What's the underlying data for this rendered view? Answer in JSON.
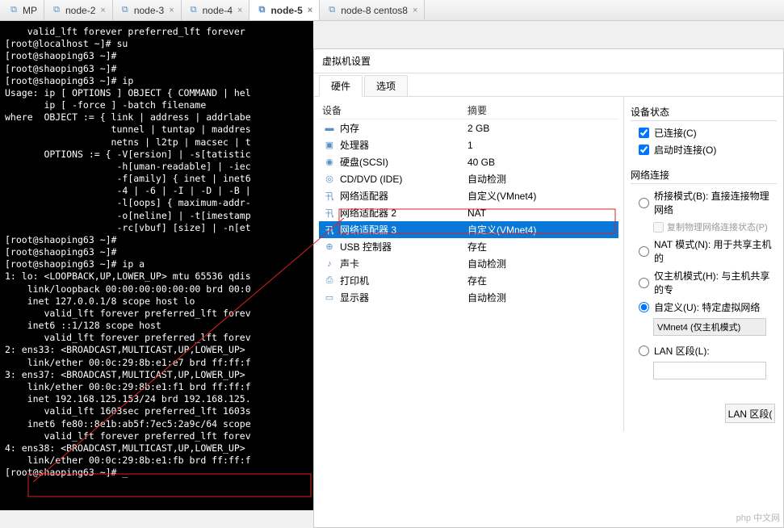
{
  "tabs": [
    {
      "label": "MP"
    },
    {
      "label": "node-2"
    },
    {
      "label": "node-3"
    },
    {
      "label": "node-4"
    },
    {
      "label": "node-5",
      "active": true
    },
    {
      "label": "node-8 centos8"
    }
  ],
  "terminal_lines": [
    "    valid_lft forever preferred_lft forever",
    "[root@localhost ~]# su",
    "[root@shaoping63 ~]#",
    "[root@shaoping63 ~]#",
    "[root@shaoping63 ~]# ip",
    "Usage: ip [ OPTIONS ] OBJECT { COMMAND | hel",
    "       ip [ -force ] -batch filename",
    "where  OBJECT := { link | address | addrlabe",
    "                   tunnel | tuntap | maddres",
    "                   netns | l2tp | macsec | t",
    "       OPTIONS := { -V[ersion] | -s[tatistic",
    "                    -h[uman-readable] | -iec",
    "                    -f[amily] { inet | inet6",
    "                    -4 | -6 | -I | -D | -B |",
    "                    -l[oops] { maximum-addr-",
    "                    -o[neline] | -t[imestamp",
    "                    -rc[vbuf] [size] | -n[et",
    "[root@shaoping63 ~]#",
    "[root@shaoping63 ~]#",
    "[root@shaoping63 ~]# ip a",
    "1: lo: <LOOPBACK,UP,LOWER_UP> mtu 65536 qdis",
    "    link/loopback 00:00:00:00:00:00 brd 00:0",
    "    inet 127.0.0.1/8 scope host lo",
    "       valid_lft forever preferred_lft forev",
    "    inet6 ::1/128 scope host",
    "       valid_lft forever preferred_lft forev",
    "2: ens33: <BROADCAST,MULTICAST,UP,LOWER_UP>",
    "    link/ether 00:0c:29:8b:e1:e7 brd ff:ff:f",
    "3: ens37: <BROADCAST,MULTICAST,UP,LOWER_UP>",
    "    link/ether 00:0c:29:8b:e1:f1 brd ff:ff:f",
    "    inet 192.168.125.153/24 brd 192.168.125.",
    "       valid_lft 1603sec preferred_lft 1603s",
    "    inet6 fe80::8e1b:ab5f:7ec5:2a9c/64 scope",
    "       valid_lft forever preferred_lft forev",
    "4: ens38: <BROADCAST,MULTICAST,UP,LOWER_UP>",
    "    link/ether 00:0c:29:8b:e1:fb brd ff:ff:f",
    "[root@shaoping63 ~]# _"
  ],
  "settings": {
    "title": "虚拟机设置",
    "tabs": {
      "hardware": "硬件",
      "options": "选项"
    },
    "columns": {
      "device": "设备",
      "summary": "摘要"
    },
    "devices": [
      {
        "icon": "▬",
        "name": "内存",
        "summary": "2 GB"
      },
      {
        "icon": "▣",
        "name": "处理器",
        "summary": "1"
      },
      {
        "icon": "◉",
        "name": "硬盘(SCSI)",
        "summary": "40 GB"
      },
      {
        "icon": "◎",
        "name": "CD/DVD (IDE)",
        "summary": "自动检测"
      },
      {
        "icon": "卂",
        "name": "网络适配器",
        "summary": "自定义(VMnet4)"
      },
      {
        "icon": "卂",
        "name": "网络适配器 2",
        "summary": "NAT"
      },
      {
        "icon": "卂",
        "name": "网络适配器 3",
        "summary": "自定义(VMnet4)",
        "selected": true
      },
      {
        "icon": "⊕",
        "name": "USB 控制器",
        "summary": "存在"
      },
      {
        "icon": "♪",
        "name": "声卡",
        "summary": "自动检测"
      },
      {
        "icon": "⎙",
        "name": "打印机",
        "summary": "存在"
      },
      {
        "icon": "▭",
        "name": "显示器",
        "summary": "自动检测"
      }
    ],
    "status": {
      "title": "设备状态",
      "connected": "已连接(C)",
      "connect_on_start": "启动时连接(O)"
    },
    "network": {
      "title": "网络连接",
      "bridged": "桥接模式(B): 直接连接物理网络",
      "replicate": "复制物理网络连接状态(P)",
      "nat": "NAT 模式(N): 用于共享主机的",
      "hostonly": "仅主机模式(H): 与主机共享的专",
      "custom": "自定义(U): 特定虚拟网络",
      "custom_value": "VMnet4 (仅主机模式)",
      "lan": "LAN 区段(L):",
      "lan_button": "LAN 区段("
    }
  },
  "watermark": "php 中文网"
}
